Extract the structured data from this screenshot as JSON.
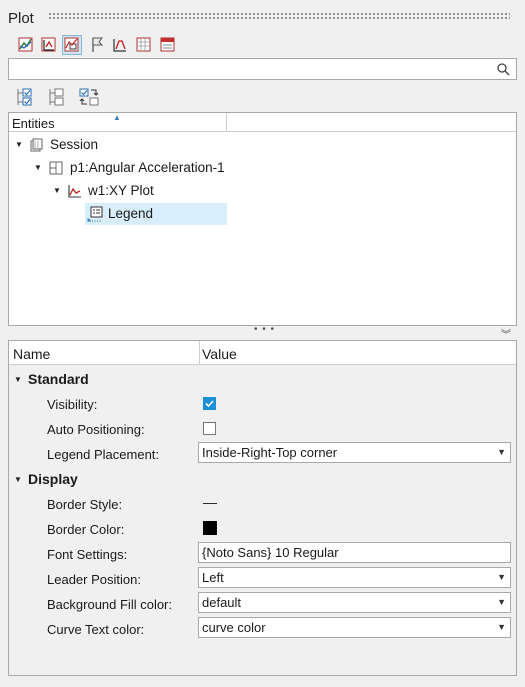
{
  "panel": {
    "title": "Plot"
  },
  "search": {
    "value": "",
    "placeholder": ""
  },
  "tree": {
    "column_header": "Entities",
    "nodes": [
      {
        "label": "Session",
        "icon": "session-icon"
      },
      {
        "label": "p1:Angular Acceleration-1",
        "icon": "page-icon"
      },
      {
        "label": "w1:XY Plot",
        "icon": "xy-plot-icon"
      },
      {
        "label": "Legend",
        "icon": "legend-icon"
      }
    ]
  },
  "properties": {
    "col_name": "Name",
    "col_value": "Value",
    "standard": {
      "title": "Standard",
      "visibility_label": "Visibility:",
      "visibility_checked": true,
      "auto_positioning_label": "Auto Positioning:",
      "auto_positioning_checked": false,
      "legend_placement_label": "Legend Placement:",
      "legend_placement_value": "Inside-Right-Top corner"
    },
    "display": {
      "title": "Display",
      "border_style_label": "Border Style:",
      "border_style_value": "—",
      "border_color_label": "Border Color:",
      "border_color_value": "#000000",
      "font_settings_label": "Font Settings:",
      "font_settings_value": "{Noto Sans} 10 Regular",
      "leader_position_label": "Leader Position:",
      "leader_position_value": "Left",
      "bg_fill_label": "Background Fill color:",
      "bg_fill_value": "default",
      "curve_text_label": "Curve Text color:",
      "curve_text_value": "curve color"
    }
  }
}
